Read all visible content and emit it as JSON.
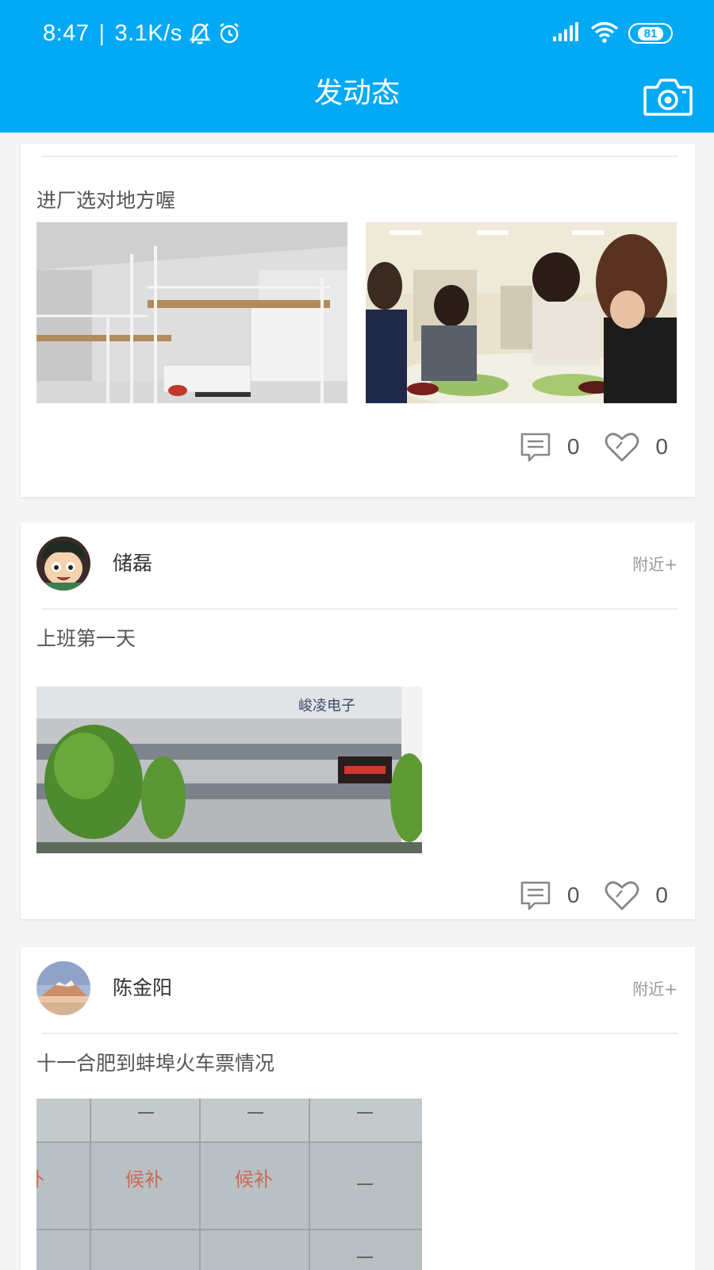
{
  "status_bar": {
    "time": "8:47",
    "speed": "3.1K/s",
    "battery": "81",
    "icons": [
      "bell-off-icon",
      "alarm-icon",
      "signal-icon",
      "wifi-icon",
      "battery-icon"
    ]
  },
  "header": {
    "title": "发动态",
    "action_icon": "camera-icon",
    "background": "#03a9f4"
  },
  "feed": {
    "posts": [
      {
        "text": "进厂选对地方喔",
        "comments": "0",
        "likes": "0"
      },
      {
        "user": "储磊",
        "location": "附近+",
        "text": "上班第一天",
        "photo_sign": "峻凌电子",
        "comments": "0",
        "likes": "0"
      },
      {
        "user": "陈金阳",
        "location": "附近+",
        "text": "十一合肥到蚌埠火车票情况",
        "ticket_cells": [
          "候补",
          "候补",
          "--",
          "--",
          "--",
          "--"
        ]
      }
    ]
  }
}
